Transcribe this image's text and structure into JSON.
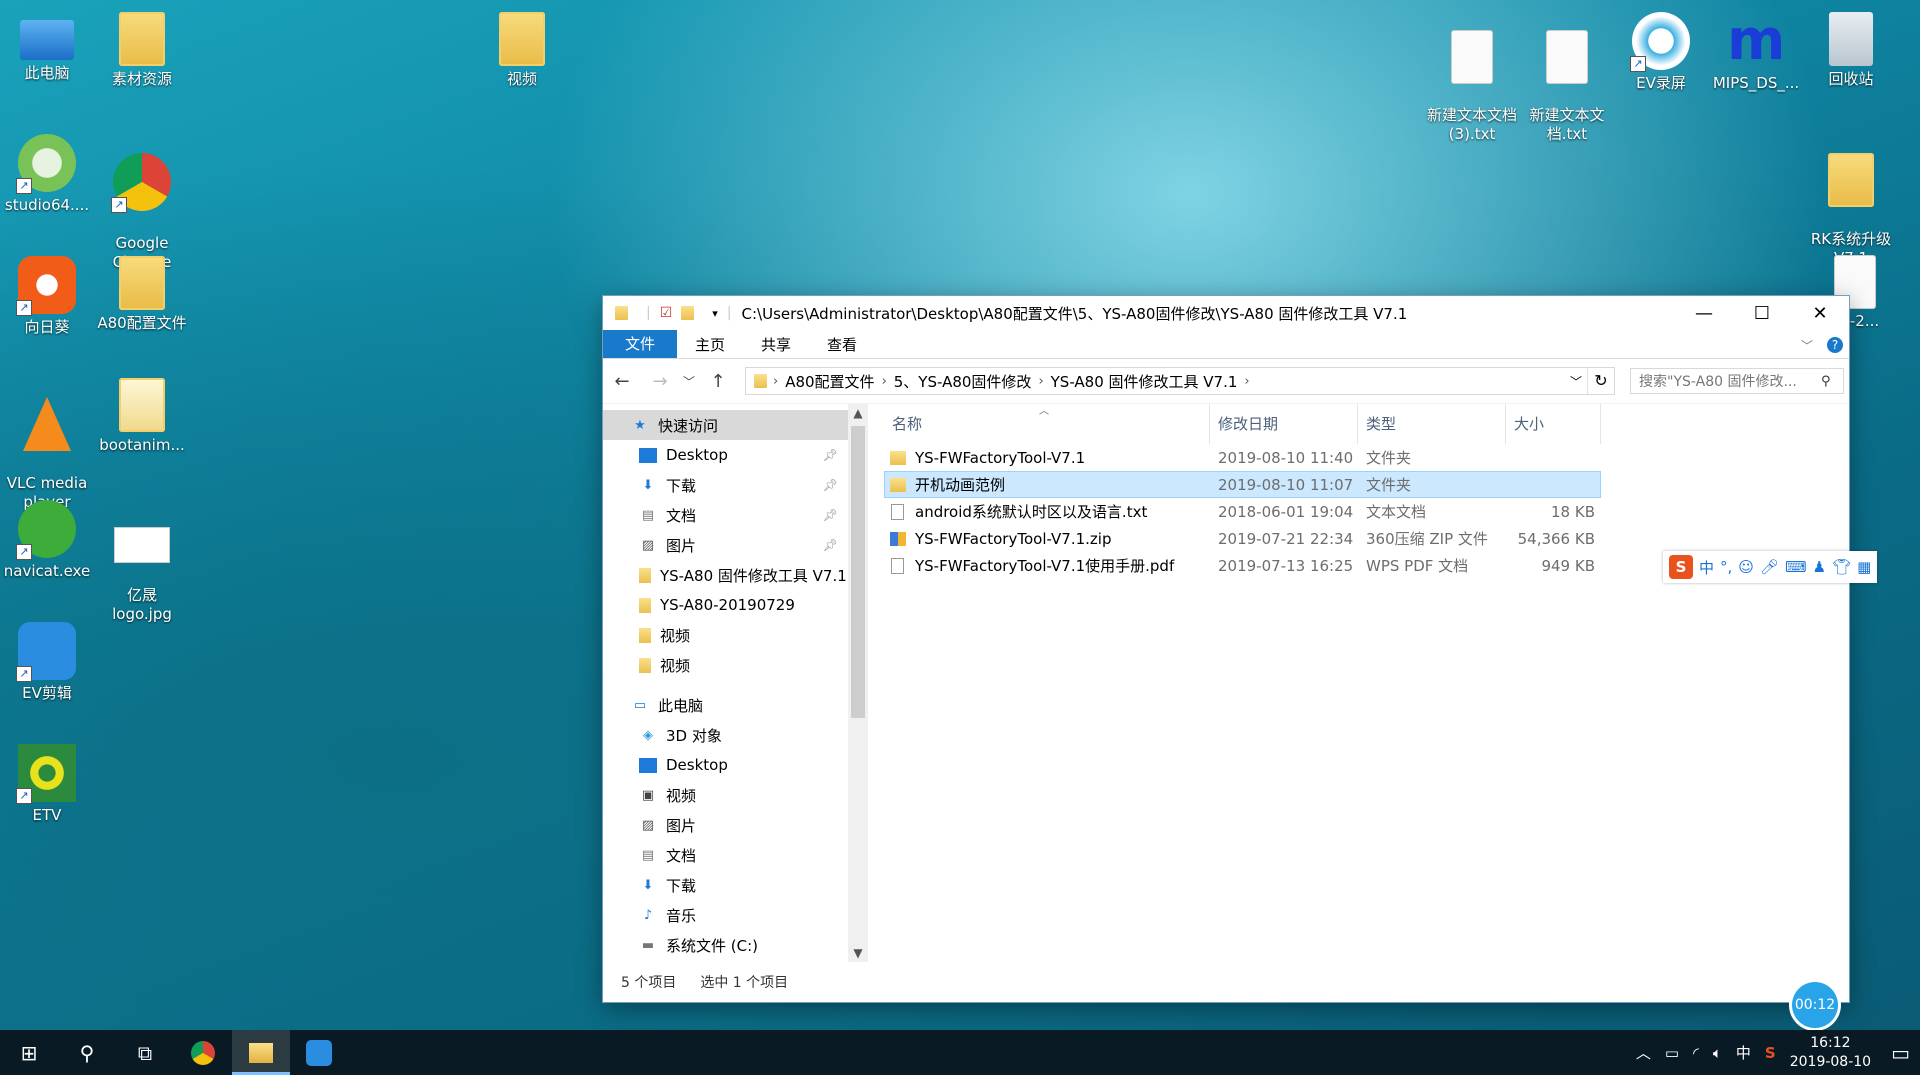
{
  "desktop": {
    "icons": [
      {
        "label": "此电脑"
      },
      {
        "label": "素材资源"
      },
      {
        "label": "视频"
      },
      {
        "label": "新建文本文档\n(3).txt"
      },
      {
        "label": "新建文本文\n档.txt"
      },
      {
        "label": "EV录屏"
      },
      {
        "label": "MIPS_DS_..."
      },
      {
        "label": "回收站"
      },
      {
        "label": "studio64...."
      },
      {
        "label": "Google\nChrome"
      },
      {
        "label": "RK系统升级\nV7.1"
      },
      {
        "label": "向日葵"
      },
      {
        "label": "A80配置文件"
      },
      {
        "label": "80-2..."
      },
      {
        "label": "VLC media\nplayer"
      },
      {
        "label": "bootanim..."
      },
      {
        "label": "navicat.exe"
      },
      {
        "label": "亿晟\nlogo.jpg"
      },
      {
        "label": "EV剪辑"
      },
      {
        "label": "ETV"
      }
    ]
  },
  "explorer": {
    "title_path": "C:\\Users\\Administrator\\Desktop\\A80配置文件\\5、YS-A80固件修改\\YS-A80 固件修改工具 V7.1",
    "window_buttons": {
      "minimize": "—",
      "maximize": "☐",
      "close": "✕"
    },
    "ribbon_tabs": [
      "文件",
      "主页",
      "共享",
      "查看"
    ],
    "breadcrumbs": [
      "A80配置文件",
      "5、YS-A80固件修改",
      "YS-A80 固件修改工具 V7.1"
    ],
    "search_placeholder": "搜索\"YS-A80 固件修改...",
    "nav_items": [
      {
        "label": "快速访问",
        "icon": "star-icon",
        "pinned": false
      },
      {
        "label": "Desktop",
        "icon": "desktop-icon",
        "pinned": true
      },
      {
        "label": "下载",
        "icon": "download-icon",
        "pinned": true
      },
      {
        "label": "文档",
        "icon": "document-icon",
        "pinned": true
      },
      {
        "label": "图片",
        "icon": "picture-icon",
        "pinned": true
      },
      {
        "label": "YS-A80 固件修改工具 V7.1",
        "icon": "folder-icon",
        "pinned": false
      },
      {
        "label": "YS-A80-20190729",
        "icon": "folder-icon",
        "pinned": false
      },
      {
        "label": "视频",
        "icon": "folder-icon",
        "pinned": false
      },
      {
        "label": "视频",
        "icon": "folder-icon",
        "pinned": false
      },
      {
        "label": "此电脑",
        "icon": "pc-icon",
        "pinned": false
      },
      {
        "label": "3D 对象",
        "icon": "cube-icon",
        "pinned": false
      },
      {
        "label": "Desktop",
        "icon": "desktop-icon",
        "pinned": false
      },
      {
        "label": "视频",
        "icon": "video-icon",
        "pinned": false
      },
      {
        "label": "图片",
        "icon": "picture-icon",
        "pinned": false
      },
      {
        "label": "文档",
        "icon": "document-icon",
        "pinned": false
      },
      {
        "label": "下载",
        "icon": "download-icon",
        "pinned": false
      },
      {
        "label": "音乐",
        "icon": "music-icon",
        "pinned": false
      },
      {
        "label": "系统文件 (C:)",
        "icon": "drive-icon",
        "pinned": false
      }
    ],
    "columns": {
      "name": "名称",
      "date": "修改日期",
      "type": "类型",
      "size": "大小"
    },
    "files": [
      {
        "name": "YS-FWFactoryTool-V7.1",
        "date": "2019-08-10 11:40",
        "type": "文件夹",
        "size": "",
        "icon": "folder-icon"
      },
      {
        "name": "开机动画范例",
        "date": "2019-08-10 11:07",
        "type": "文件夹",
        "size": "",
        "icon": "folder-icon"
      },
      {
        "name": "android系统默认时区以及语言.txt",
        "date": "2018-06-01 19:04",
        "type": "文本文档",
        "size": "18 KB",
        "icon": "text-file-icon"
      },
      {
        "name": "YS-FWFactoryTool-V7.1.zip",
        "date": "2019-07-21 22:34",
        "type": "360压缩 ZIP 文件",
        "size": "54,366 KB",
        "icon": "zip-file-icon"
      },
      {
        "name": "YS-FWFactoryTool-V7.1使用手册.pdf",
        "date": "2019-07-13 16:25",
        "type": "WPS PDF 文档",
        "size": "949 KB",
        "icon": "pdf-file-icon"
      }
    ],
    "selected_file_index": 1,
    "status": {
      "count": "5 个项目",
      "selected": "选中 1 个项目"
    }
  },
  "ime_toolbar": {
    "labels": [
      "中",
      "°,"
    ]
  },
  "taskbar": {
    "tray_lang": "中",
    "time": "16:12",
    "date": "2019-08-10"
  },
  "recorder_badge": "00:12",
  "colors": {
    "accent": "#1979ca",
    "selection": "#cce8ff"
  }
}
